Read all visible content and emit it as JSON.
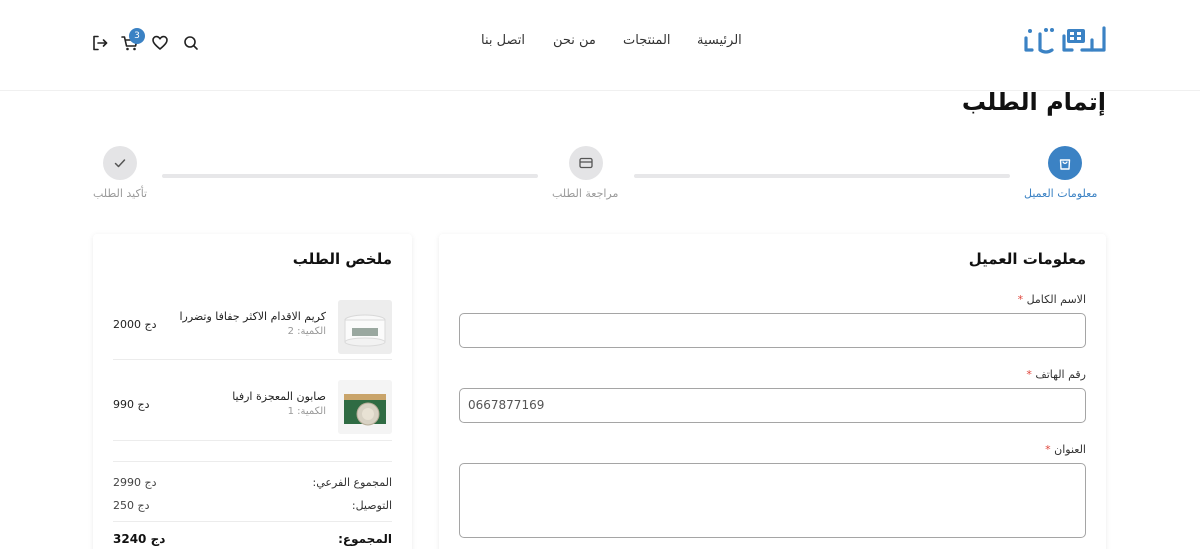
{
  "header": {
    "logo_text": "حانوتنا",
    "nav": {
      "home": "الرئيسية",
      "products": "المنتجات",
      "about": "من نحن",
      "contact": "اتصل بنا"
    },
    "cart_count": "3",
    "icons": [
      "search-icon",
      "heart-icon",
      "cart-icon",
      "logout-icon"
    ]
  },
  "page": {
    "title": "إتمام الطلب"
  },
  "stepper": {
    "steps": [
      {
        "label": "معلومات العميل",
        "icon": "shopping-bag-icon",
        "state": "active"
      },
      {
        "label": "مراجعة الطلب",
        "icon": "credit-card-icon",
        "state": "pending"
      },
      {
        "label": "تأكيد الطلب",
        "icon": "check-icon",
        "state": "pending"
      }
    ]
  },
  "form": {
    "title": "معلومات العميل",
    "required_mark": "*",
    "fields": {
      "name": {
        "label": "الاسم الكامل",
        "value": ""
      },
      "phone": {
        "label": "رقم الهاتف",
        "value": "0667877169"
      },
      "address": {
        "label": "العنوان",
        "value": ""
      }
    }
  },
  "summary": {
    "title": "ملخص الطلب",
    "items": [
      {
        "name": "كريم الاقدام الاكثر جفافا وتضررا",
        "qty": "الكمية: 2",
        "price": "2000 دج"
      },
      {
        "name": "صابون المعجزة ارفيا",
        "qty": "الكمية: 1",
        "price": "990 دج"
      }
    ],
    "subtotal_label": "المجموع الفرعي:",
    "subtotal_value": "2990 دج",
    "shipping_label": "التوصيل:",
    "shipping_value": "250 دج",
    "total_label": "المجموع:",
    "total_value": "3240 دج"
  },
  "colors": {
    "accent": "#3b82c4",
    "step_inactive": "#e4e4e6",
    "required": "#e0463c"
  }
}
